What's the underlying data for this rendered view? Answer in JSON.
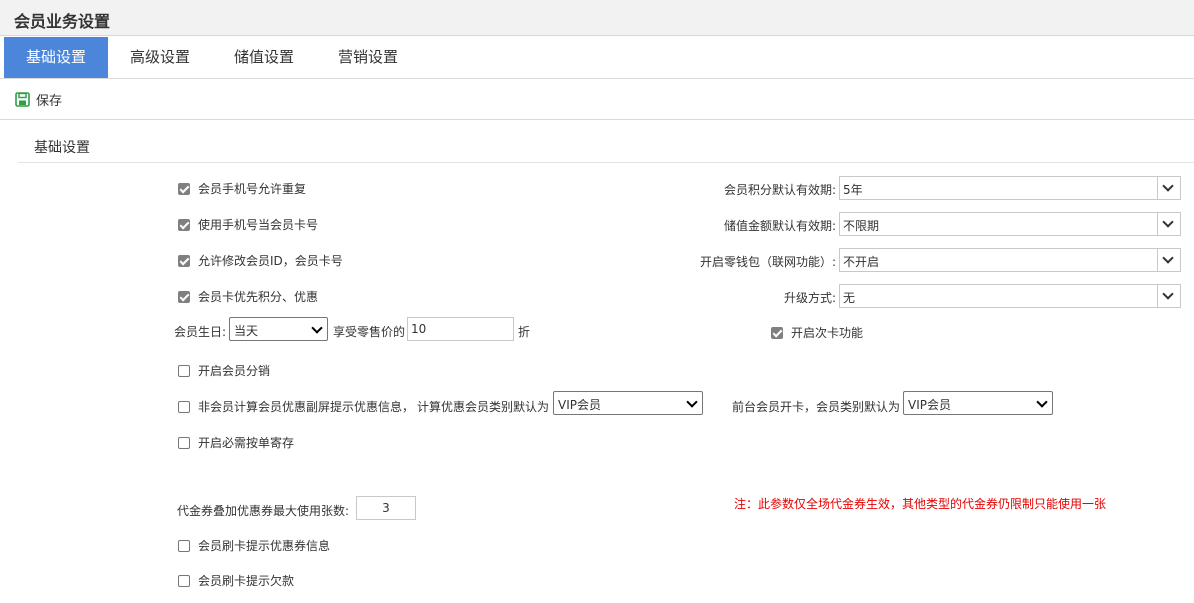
{
  "window": {
    "title": "会员业务设置"
  },
  "tabs": [
    {
      "label": "基础设置",
      "active": true
    },
    {
      "label": "高级设置"
    },
    {
      "label": "储值设置"
    },
    {
      "label": "营销设置"
    }
  ],
  "toolbar": {
    "save_label": "保存",
    "save_icon": "save-disk-icon",
    "save_icon_color": "#2f9e44"
  },
  "section": {
    "title": "基础设置"
  },
  "left_options": {
    "allow_dup_phone": {
      "label": "会员手机号允许重复",
      "checked": true
    },
    "phone_as_card": {
      "label": "使用手机号当会员卡号",
      "checked": true
    },
    "allow_edit_id": {
      "label": "允许修改会员ID，会员卡号",
      "checked": true
    },
    "card_priority": {
      "label": "会员卡优先积分、优惠",
      "checked": true
    },
    "birthday": {
      "label": "会员生日:",
      "select_value": "当天",
      "discount_label": "享受零售价的",
      "discount_value": "10",
      "unit": "折"
    },
    "enable_distribution": {
      "label": "开启会员分销",
      "checked": false
    },
    "non_member_prompt": {
      "label": "非会员计算会员优惠副屏提示优惠信息，",
      "checked": false,
      "calc_label": "计算优惠会员类别默认为",
      "calc_value": "VIP会员"
    },
    "front_card": {
      "label": "前台会员开卡，会员类别默认为",
      "value": "VIP会员"
    },
    "order_storage": {
      "label": "开启必需按单寄存",
      "checked": false
    },
    "coupon_stack": {
      "label": "代金券叠加优惠券最大使用张数:",
      "value": "3"
    },
    "swipe_coupon_tip": {
      "label": "会员刷卡提示优惠券信息",
      "checked": false
    },
    "swipe_debt_tip": {
      "label": "会员刷卡提示欠款",
      "checked": false
    }
  },
  "right_options": {
    "points_validity": {
      "label": "会员积分默认有效期:",
      "value": "5年"
    },
    "stored_validity": {
      "label": "储值金额默认有效期:",
      "value": "不限期"
    },
    "wallet": {
      "label": "开启零钱包（联网功能）:",
      "value": "不开启"
    },
    "upgrade": {
      "label": "升级方式:",
      "value": "无"
    },
    "secondary_card": {
      "label": "开启次卡功能",
      "checked": true
    }
  },
  "note": {
    "text": "注：此参数仅全场代金券生效，其他类型的代金券仍限制只能使用一张",
    "color": "#e60000"
  },
  "colors": {
    "tab_active": "#4b86db",
    "title_bar": "#f2f2f2"
  }
}
